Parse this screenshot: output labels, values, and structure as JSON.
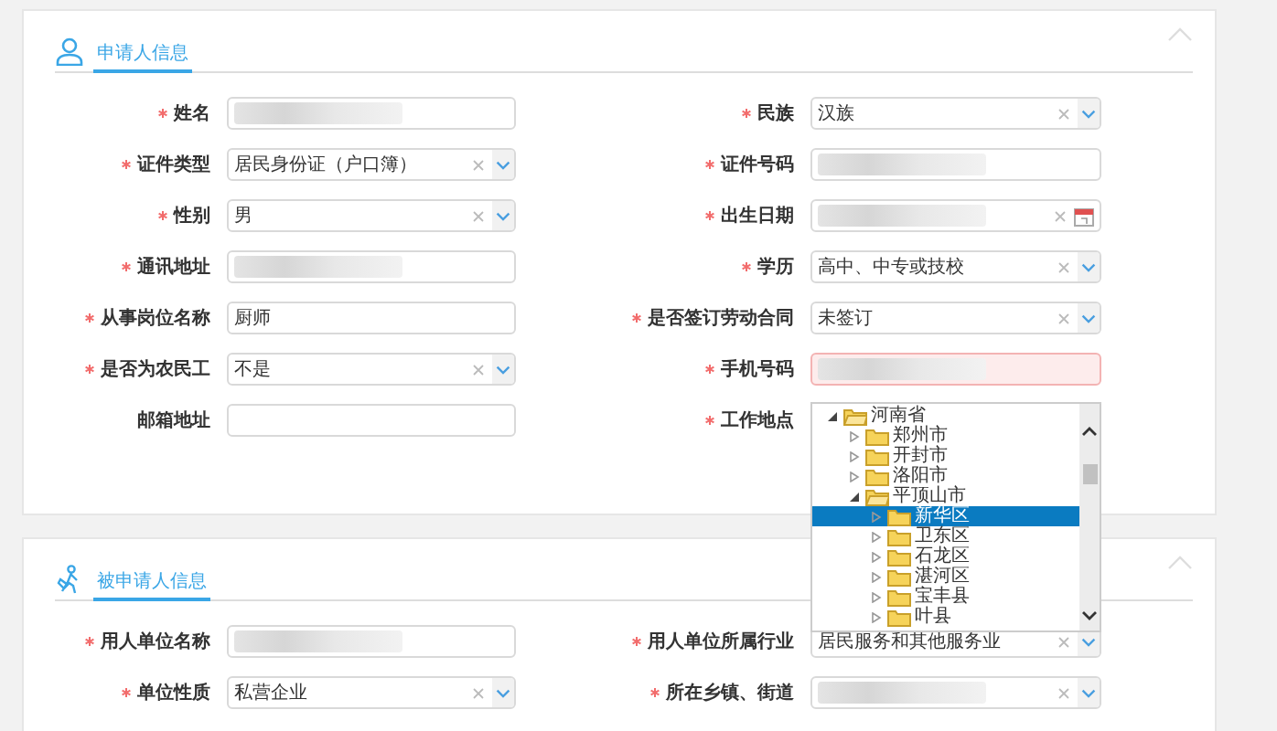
{
  "sections": [
    {
      "title": "申请人信息",
      "fields": [
        {
          "label": "姓名",
          "required": true,
          "kind": "text",
          "redacted": true
        },
        {
          "label": "民族",
          "required": true,
          "kind": "select",
          "value": "汉族"
        },
        {
          "label": "证件类型",
          "required": true,
          "kind": "select",
          "value": "居民身份证（户口簿）"
        },
        {
          "label": "证件号码",
          "required": true,
          "kind": "text",
          "redacted": true
        },
        {
          "label": "性别",
          "required": true,
          "kind": "select",
          "value": "男"
        },
        {
          "label": "出生日期",
          "required": true,
          "kind": "date",
          "redacted": true
        },
        {
          "label": "通讯地址",
          "required": true,
          "kind": "text",
          "redacted": true
        },
        {
          "label": "学历",
          "required": true,
          "kind": "select",
          "value": "高中、中专或技校"
        },
        {
          "label": "从事岗位名称",
          "required": true,
          "kind": "text",
          "value": "厨师"
        },
        {
          "label": "是否签订劳动合同",
          "required": true,
          "kind": "select",
          "value": "未签订"
        },
        {
          "label": "是否为农民工",
          "required": true,
          "kind": "select",
          "value": "不是"
        },
        {
          "label": "手机号码",
          "required": true,
          "kind": "text",
          "redacted": true,
          "invalid": true
        },
        {
          "label": "邮箱地址",
          "required": false,
          "kind": "text"
        },
        {
          "label": "工作地点",
          "required": true,
          "kind": "tree",
          "tree": [
            {
              "label": "河南省",
              "expanded": true,
              "selected": false,
              "children": [
                {
                  "label": "郑州市",
                  "expanded": false,
                  "selected": false
                },
                {
                  "label": "开封市",
                  "expanded": false,
                  "selected": false
                },
                {
                  "label": "洛阳市",
                  "expanded": false,
                  "selected": false
                },
                {
                  "label": "平顶山市",
                  "expanded": true,
                  "selected": false,
                  "children": [
                    {
                      "label": "新华区",
                      "expanded": false,
                      "selected": true
                    },
                    {
                      "label": "卫东区",
                      "expanded": false,
                      "selected": false
                    },
                    {
                      "label": "石龙区",
                      "expanded": false,
                      "selected": false
                    },
                    {
                      "label": "湛河区",
                      "expanded": false,
                      "selected": false
                    },
                    {
                      "label": "宝丰县",
                      "expanded": false,
                      "selected": false
                    },
                    {
                      "label": "叶县",
                      "expanded": false,
                      "selected": false
                    }
                  ]
                }
              ]
            }
          ]
        }
      ]
    },
    {
      "title": "被申请人信息",
      "fields": [
        {
          "label": "用人单位名称",
          "required": true,
          "kind": "text",
          "redacted": true
        },
        {
          "label": "用人单位所属行业",
          "required": true,
          "kind": "select",
          "value": "居民服务和其他服务业"
        },
        {
          "label": "单位性质",
          "required": true,
          "kind": "select",
          "value": "私营企业"
        },
        {
          "label": "所在乡镇、街道",
          "required": true,
          "kind": "select",
          "redacted": true
        }
      ]
    }
  ]
}
